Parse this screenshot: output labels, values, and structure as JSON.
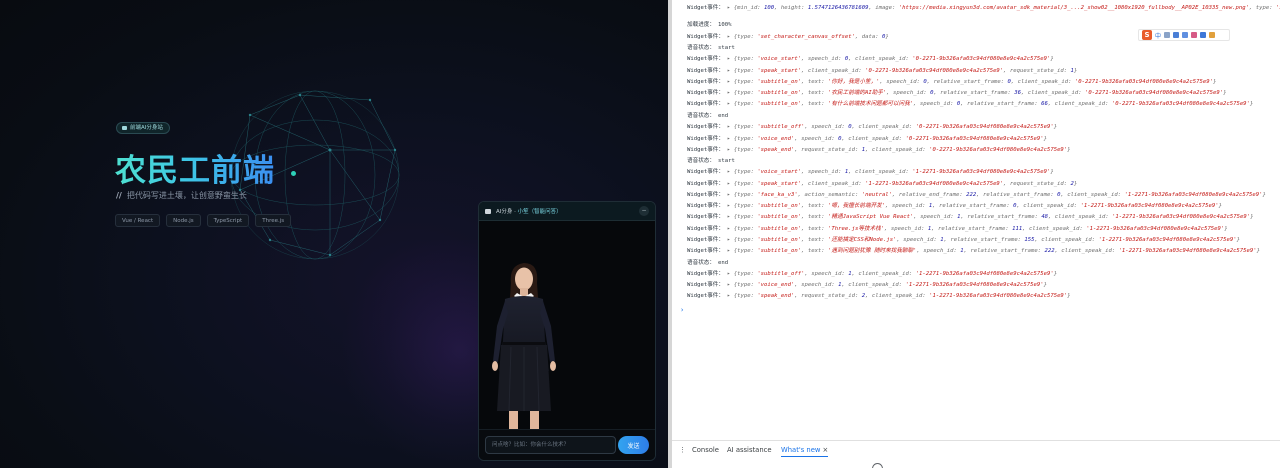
{
  "page": {
    "badge": "前端AI分身站",
    "title": "农民工前端",
    "subtitle_prefix": "//",
    "subtitle": "把代码写进土壤，让创意野蛮生长",
    "tags": [
      "Vue / React",
      "Node.js",
      "TypeScript",
      "Three.js"
    ],
    "accent": "#3ec7e6"
  },
  "chat": {
    "title_prefix": "AI分身 · ",
    "title_accent": "小笙（智能问答）",
    "minimize_icon": "minus-icon",
    "input_placeholder": "问点啥？比如：你会什么技术？",
    "send_label": "发送"
  },
  "devtools": {
    "ime_logo": "S",
    "ime_mode": "中",
    "lines": [
      {
        "label": "Widget事件：",
        "raw": "▸ {min_id: 100, height: 1.5747126436781609, image: 'https://media.xingyun3d.com/avatar_sdk_material/3_...2_show02__1080x1920_fullbody__AP02E_10335_new.png', type: 'SetCharacterCanvasAnchor', width: 1.5747126436781609, ...}"
      },
      {
        "label": "加载进度：",
        "raw": "100%"
      },
      {
        "label": "Widget事件：",
        "raw": "▸ {type: 'set_character_canvas_offset', data: 0}"
      },
      {
        "label": "语音状态：",
        "raw": "start"
      },
      {
        "label": "Widget事件：",
        "raw": "▸ {type: 'voice_start', speech_id: 0, client_speak_id: '0-2271-9b326afa03c94df080e8e9c4a2c575e9'}"
      },
      {
        "label": "Widget事件：",
        "raw": "▸ {type: 'speak_start', client_speak_id: '0-2271-9b326afa03c94df080e8e9c4a2c575e9', request_state_id: 1}"
      },
      {
        "label": "Widget事件：",
        "raw": "▸ {type: 'subtitle_on', text: '你好，我是小笙，', speech_id: 0, relative_start_frame: 0, client_speak_id: '0-2271-9b326afa03c94df080e8e9c4a2c575e9'}"
      },
      {
        "label": "Widget事件：",
        "raw": "▸ {type: 'subtitle_on', text: '农民工前端的AI助手', speech_id: 0, relative_start_frame: 36, client_speak_id: '0-2271-9b326afa03c94df080e8e9c4a2c575e9'}"
      },
      {
        "label": "Widget事件：",
        "raw": "▸ {type: 'subtitle_on', text: '有什么前端技术问题都可以问我', speech_id: 0, relative_start_frame: 66, client_speak_id: '0-2271-9b326afa03c94df080e8e9c4a2c575e9'}"
      },
      {
        "label": "语音状态：",
        "raw": "end"
      },
      {
        "label": "Widget事件：",
        "raw": "▸ {type: 'subtitle_off', speech_id: 0, client_speak_id: '0-2271-9b326afa03c94df080e8e9c4a2c575e9'}"
      },
      {
        "label": "Widget事件：",
        "raw": "▸ {type: 'voice_end', speech_id: 0, client_speak_id: '0-2271-9b326afa03c94df080e8e9c4a2c575e9'}"
      },
      {
        "label": "Widget事件：",
        "raw": "▸ {type: 'speak_end', request_state_id: 1, client_speak_id: '0-2271-9b326afa03c94df080e8e9c4a2c575e9'}"
      },
      {
        "label": "语音状态：",
        "raw": "start"
      },
      {
        "label": "Widget事件：",
        "raw": "▸ {type: 'voice_start', speech_id: 1, client_speak_id: '1-2271-9b326afa03c94df080e8e9c4a2c575e9'}"
      },
      {
        "label": "Widget事件：",
        "raw": "▸ {type: 'speak_start', client_speak_id: '1-2271-9b326afa03c94df080e8e9c4a2c575e9', request_state_id: 2}"
      },
      {
        "label": "Widget事件：",
        "raw": "▸ {type: 'face_ka_v3', action_semantic: 'neutral', relative_end_frame: 222, relative_start_frame: 0, client_speak_id: '1-2271-9b326afa03c94df080e8e9c4a2c575e9'}"
      },
      {
        "label": "Widget事件：",
        "raw": "▸ {type: 'subtitle_on', text: '嗯，我擅长前端开发', speech_id: 1, relative_start_frame: 0, client_speak_id: '1-2271-9b326afa03c94df080e8e9c4a2c575e9'}"
      },
      {
        "label": "Widget事件：",
        "raw": "▸ {type: 'subtitle_on', text: '精通JavaScript Vue React', speech_id: 1, relative_start_frame: 48, client_speak_id: '1-2271-9b326afa03c94df080e8e9c4a2c575e9'}"
      },
      {
        "label": "Widget事件：",
        "raw": "▸ {type: 'subtitle_on', text: 'Three.js等技术栈', speech_id: 1, relative_start_frame: 111, client_speak_id: '1-2271-9b326afa03c94df080e8e9c4a2c575e9'}"
      },
      {
        "label": "Widget事件：",
        "raw": "▸ {type: 'subtitle_on', text: '还能搞定CSS和Node.js', speech_id: 1, relative_start_frame: 155, client_speak_id: '1-2271-9b326afa03c94df080e8e9c4a2c575e9'}"
      },
      {
        "label": "Widget事件：",
        "raw": "▸ {type: 'subtitle_on', text: '遇到问题别犹豫 随时来找我聊聊', speech_id: 1, relative_start_frame: 222, client_speak_id: '1-2271-9b326afa03c94df080e8e9c4a2c575e9'}"
      },
      {
        "label": "语音状态：",
        "raw": "end"
      },
      {
        "label": "Widget事件：",
        "raw": "▸ {type: 'subtitle_off', speech_id: 1, client_speak_id: '1-2271-9b326afa03c94df080e8e9c4a2c575e9'}"
      },
      {
        "label": "Widget事件：",
        "raw": "▸ {type: 'voice_end', speech_id: 1, client_speak_id: '1-2271-9b326afa03c94df080e8e9c4a2c575e9'}"
      },
      {
        "label": "Widget事件：",
        "raw": "▸ {type: 'speak_end', request_state_id: 2, client_speak_id: '1-2271-9b326afa03c94df080e8e9c4a2c575e9'}"
      }
    ],
    "prompt": "›",
    "drawer_tabs": [
      {
        "label": "Console",
        "active": false
      },
      {
        "label": "AI assistance",
        "active": false
      },
      {
        "label": "What's new",
        "active": true
      }
    ],
    "tab_close": "×"
  }
}
